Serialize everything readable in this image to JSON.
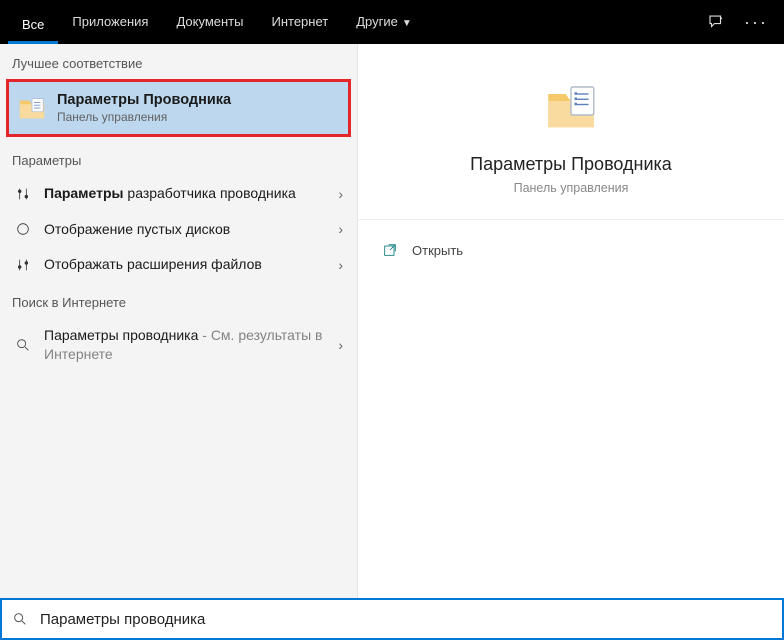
{
  "topbar": {
    "tabs": [
      {
        "label": "Все",
        "active": true
      },
      {
        "label": "Приложения",
        "active": false
      },
      {
        "label": "Документы",
        "active": false
      },
      {
        "label": "Интернет",
        "active": false
      },
      {
        "label": "Другие",
        "active": false,
        "dropdown": true
      }
    ]
  },
  "sections": {
    "best_match_header": "Лучшее соответствие",
    "settings_header": "Параметры",
    "web_header": "Поиск в Интернете"
  },
  "best_match": {
    "title": "Параметры Проводника",
    "subtitle": "Панель управления"
  },
  "settings_rows": [
    {
      "prefix_bold": "Параметры",
      "rest": " разработчика проводника"
    },
    {
      "text": "Отображение пустых дисков"
    },
    {
      "text": "Отображать расширения файлов"
    }
  ],
  "web_rows": [
    {
      "title": "Параметры проводника",
      "suffix": " - См. результаты в Интернете"
    }
  ],
  "detail": {
    "title": "Параметры Проводника",
    "subtitle": "Панель управления",
    "open_label": "Открыть"
  },
  "search": {
    "value": "Параметры проводника"
  }
}
